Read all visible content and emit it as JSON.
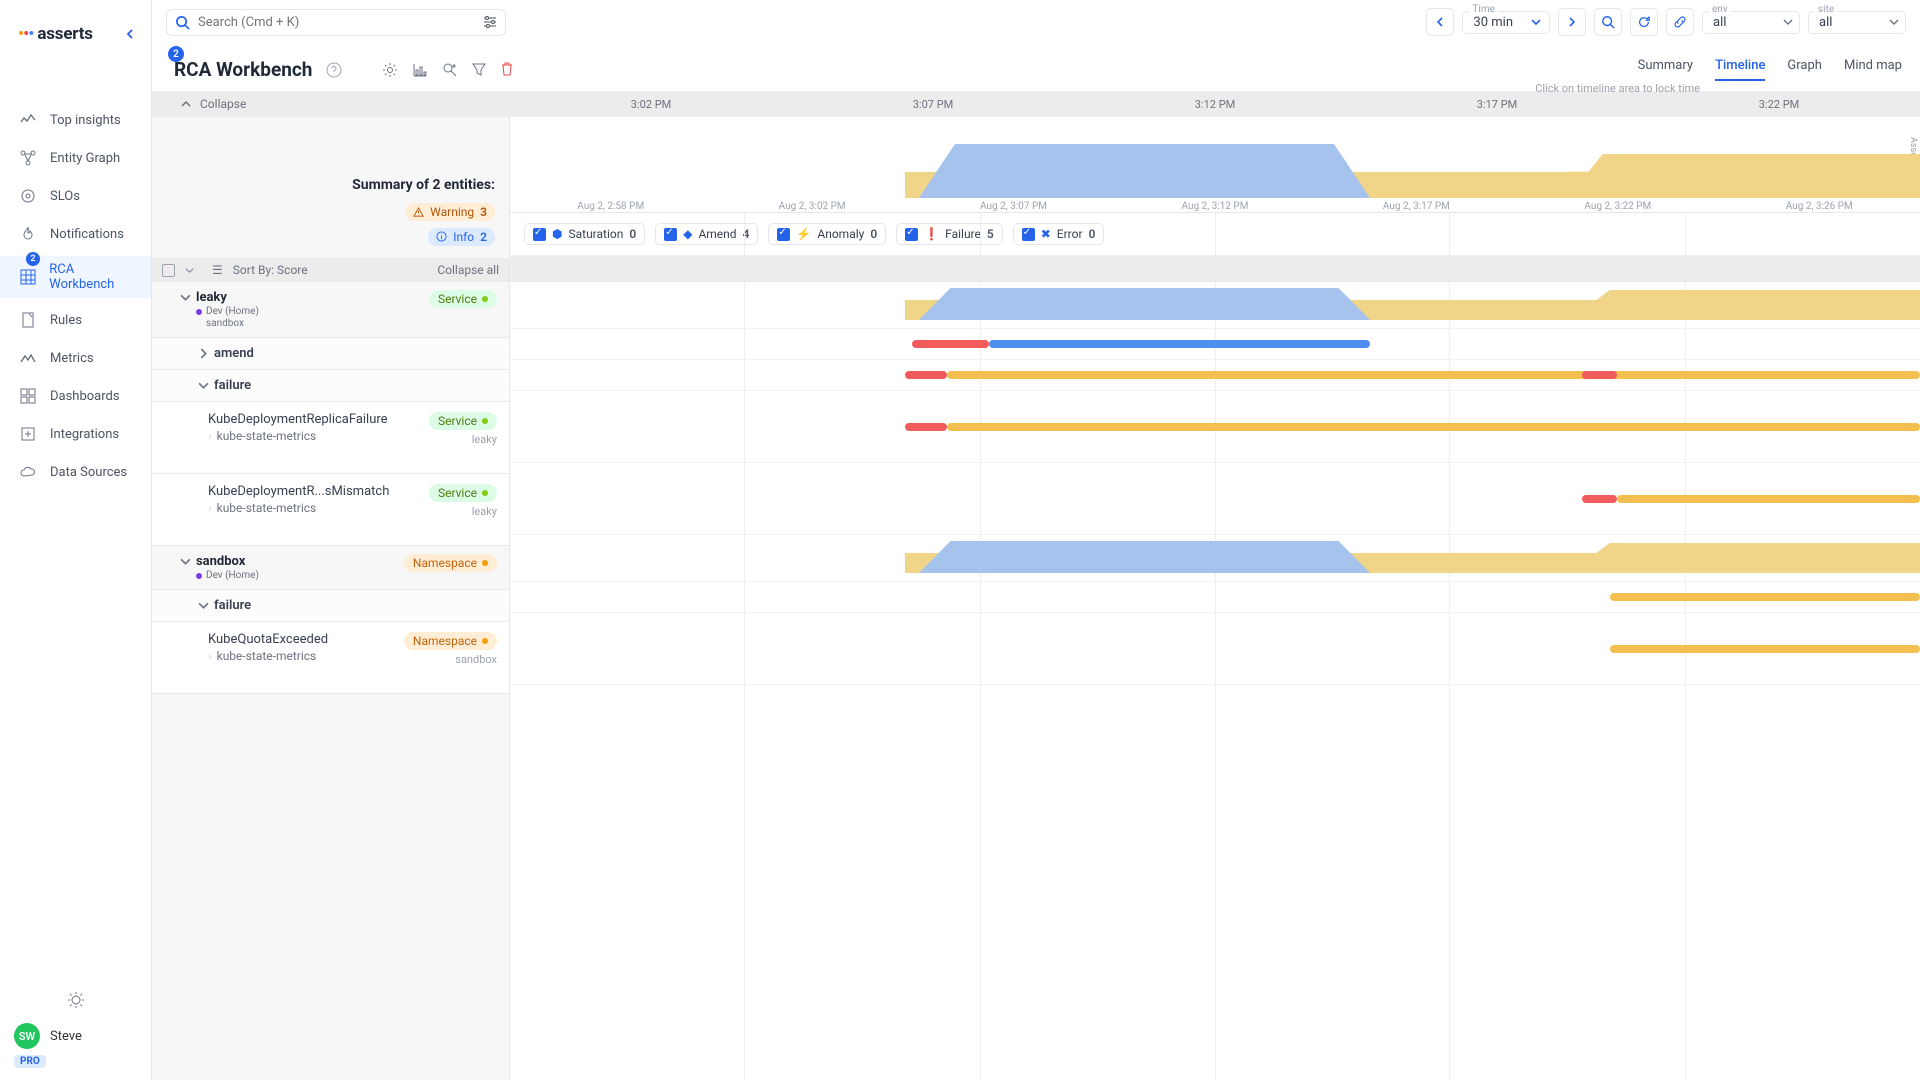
{
  "brand": "asserts",
  "search": {
    "placeholder": "Search (Cmd + K)"
  },
  "time": {
    "label": "Time",
    "value": "30 min"
  },
  "env": {
    "label": "env",
    "value": "all"
  },
  "site": {
    "label": "site",
    "value": "all"
  },
  "nav": {
    "items": [
      "Top insights",
      "Entity Graph",
      "SLOs",
      "Notifications",
      "RCA Workbench",
      "Rules",
      "Metrics",
      "Dashboards",
      "Integrations",
      "Data Sources"
    ],
    "activeIndex": 4,
    "badge": "2"
  },
  "user": {
    "initials": "SW",
    "name": "Steve",
    "plan": "PRO"
  },
  "page": {
    "title": "RCA Workbench",
    "titleBadge": "2",
    "lockHint": "Click on timeline area to lock time",
    "tabs": [
      "Summary",
      "Timeline",
      "Graph",
      "Mind map"
    ],
    "activeTab": 1
  },
  "timelineHeader": {
    "collapseLabel": "Collapse",
    "ticks": [
      "3:02 PM",
      "3:07 PM",
      "3:12 PM",
      "3:17 PM",
      "3:22 PM"
    ]
  },
  "overviewAxis": [
    "Aug 2, 2:58 PM",
    "Aug 2, 3:02 PM",
    "Aug 2, 3:07 PM",
    "Aug 2, 3:12 PM",
    "Aug 2, 3:17 PM",
    "Aug 2, 3:22 PM",
    "Aug 2, 3:26 PM"
  ],
  "scoreLabel": "Asserts Score",
  "summary": {
    "title": "Summary of 2 entities:",
    "warningLabel": "Warning",
    "warningCount": "3",
    "infoLabel": "Info",
    "infoCount": "2"
  },
  "sort": {
    "label": "Sort By: Score",
    "collapseAll": "Collapse all"
  },
  "filters": [
    {
      "label": "Saturation",
      "count": "0"
    },
    {
      "label": "Amend",
      "count": "4"
    },
    {
      "label": "Anomaly",
      "count": "0"
    },
    {
      "label": "Failure",
      "count": "5"
    },
    {
      "label": "Error",
      "count": "0"
    }
  ],
  "entities": {
    "leaky": {
      "name": "leaky",
      "meta1": "Dev (Home)",
      "meta2": "sandbox",
      "chip": "Service",
      "cats": {
        "amend": "amend",
        "failure": "failure"
      },
      "alerts": [
        {
          "title": "KubeDeploymentReplicaFailure",
          "sub": "kube-state-metrics",
          "chip": "Service",
          "scope": "leaky"
        },
        {
          "title": "KubeDeploymentR...sMismatch",
          "sub": "kube-state-metrics",
          "chip": "Service",
          "scope": "leaky"
        }
      ]
    },
    "sandbox": {
      "name": "sandbox",
      "meta1": "Dev (Home)",
      "chip": "Namespace",
      "cats": {
        "failure": "failure"
      },
      "alerts": [
        {
          "title": "KubeQuotaExceeded",
          "sub": "kube-state-metrics",
          "chip": "Namespace",
          "scope": "sandbox"
        }
      ]
    }
  }
}
